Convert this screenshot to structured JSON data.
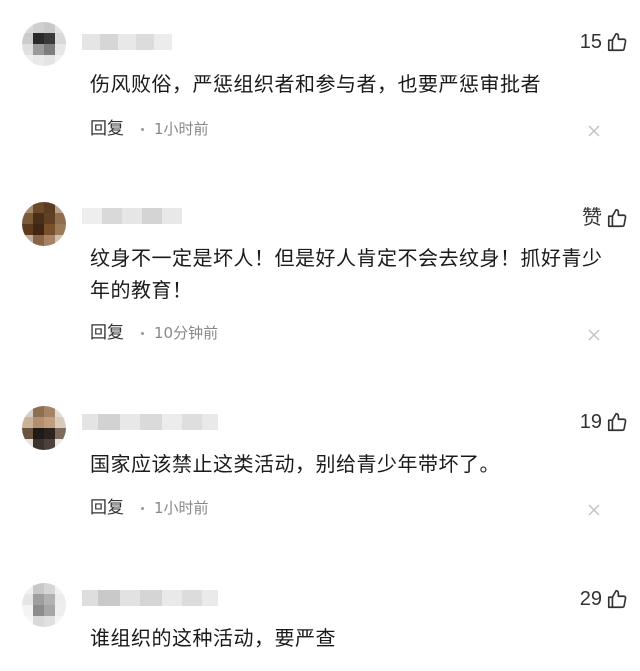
{
  "comments": [
    {
      "likes": "15",
      "text": "伤风败俗，严惩组织者和参与者，也要严惩审批者",
      "reply_label": "回复",
      "time": "1小时前"
    },
    {
      "likes": "赞",
      "text": "纹身不一定是坏人！但是好人肯定不会去纹身！抓好青少年的教育！",
      "reply_label": "回复",
      "time": "10分钟前"
    },
    {
      "likes": "19",
      "text": "国家应该禁止这类活动，别给青少年带坏了。",
      "reply_label": "回复",
      "time": "1小时前"
    },
    {
      "likes": "29",
      "text": "谁组织的这种活动，要严查",
      "reply_label": "",
      "time": ""
    }
  ],
  "icons": {
    "like": "thumbs-up-icon",
    "close": "close-icon"
  },
  "colors": {
    "text": "#1a1a1a",
    "meta": "#888888",
    "icon": "#333333"
  }
}
